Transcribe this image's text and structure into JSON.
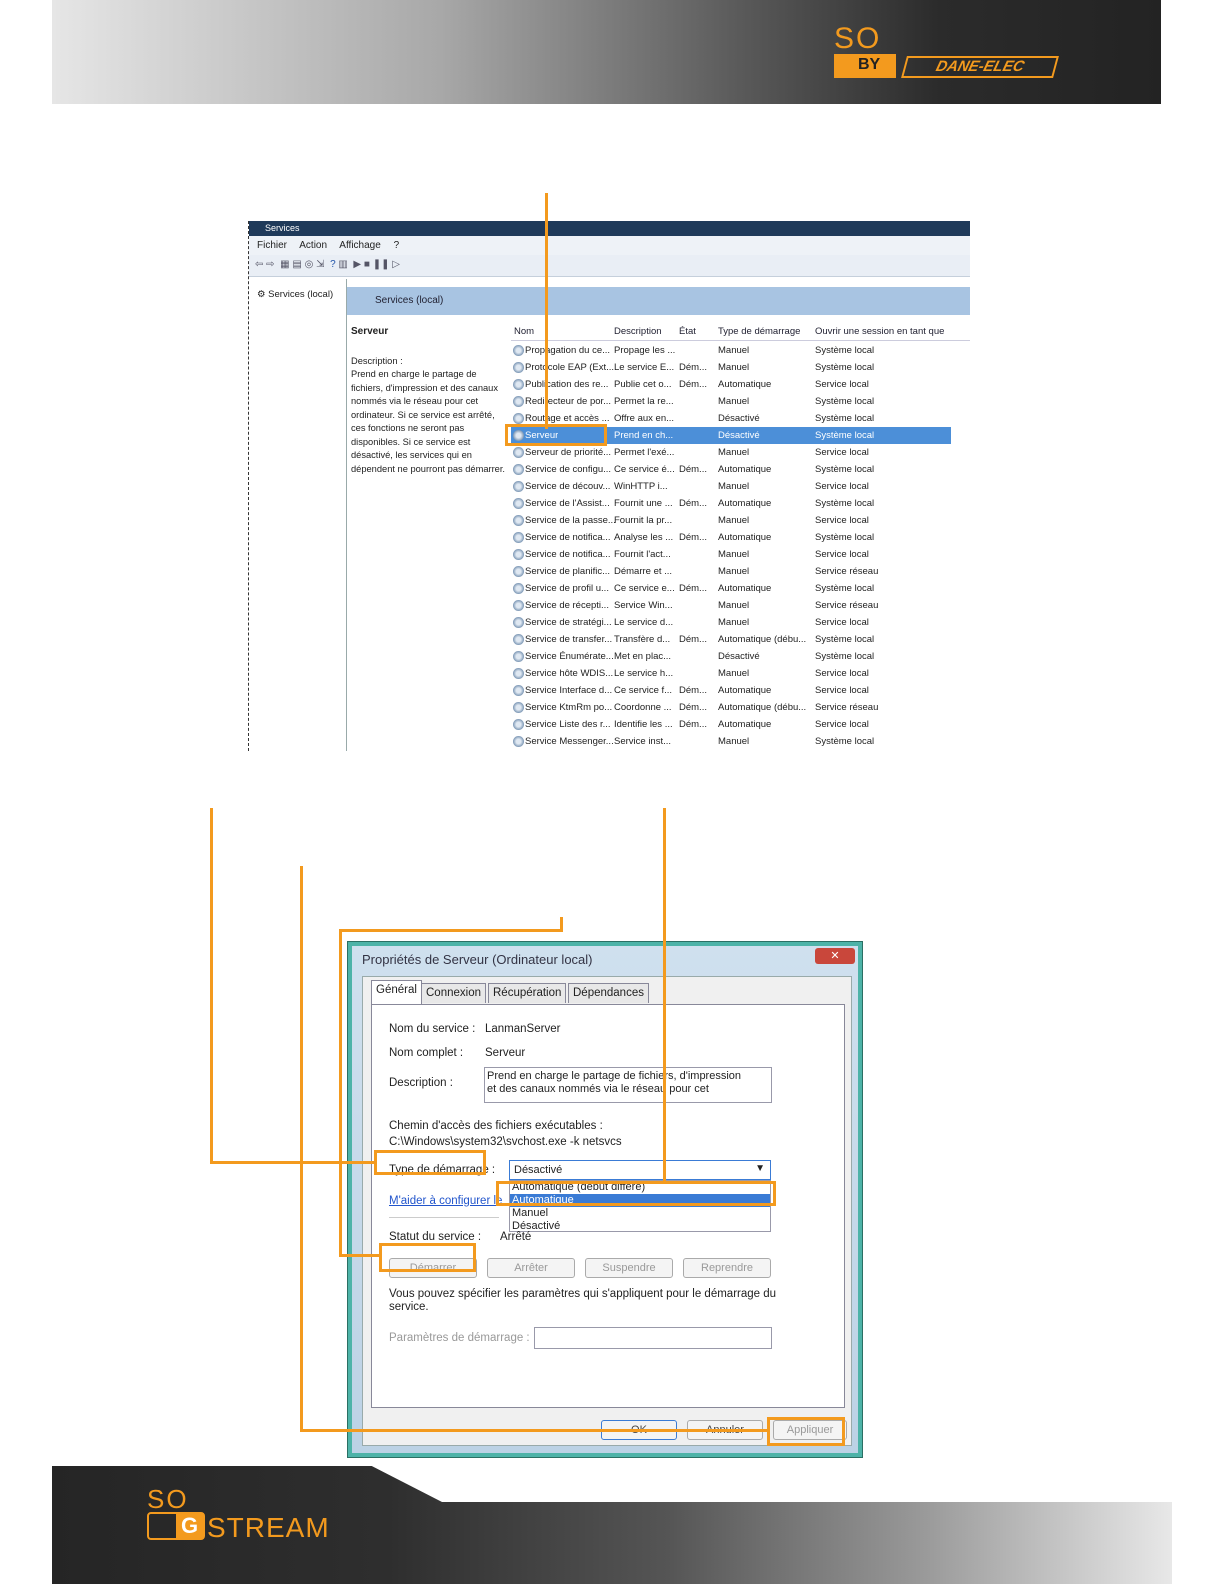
{
  "header": {
    "brand_top": "SO",
    "brand_by": "BY",
    "brand_name": "DANE-ELEC"
  },
  "footer": {
    "brand_top": "SO",
    "brand_g": "G",
    "brand_name": "STREAM"
  },
  "services_window": {
    "title": "Services",
    "menu": [
      "Fichier",
      "Action",
      "Affichage",
      "?"
    ],
    "tree_item": "Services (local)",
    "right_header": "Services (local)",
    "selected_name": "Serveur",
    "description_label": "Description :",
    "description_text": "Prend en charge le partage de fichiers, d'impression et des canaux nommés via le réseau pour cet ordinateur. Si ce service est arrêté, ces fonctions ne seront pas disponibles. Si ce service est désactivé, les services qui en dépendent ne pourront pas démarrer.",
    "columns": [
      "Nom",
      "Description",
      "État",
      "Type de démarrage",
      "Ouvrir une session en tant que"
    ],
    "rows": [
      [
        "Propagation du ce...",
        "Propage les ...",
        "",
        "Manuel",
        "Système local"
      ],
      [
        "Protocole EAP (Ext...",
        "Le service E...",
        "Dém...",
        "Manuel",
        "Système local"
      ],
      [
        "Publication des re...",
        "Publie cet o...",
        "Dém...",
        "Automatique",
        "Service local"
      ],
      [
        "Redirecteur de por...",
        "Permet la re...",
        "",
        "Manuel",
        "Système local"
      ],
      [
        "Routage et accès ...",
        "Offre aux en...",
        "",
        "Désactivé",
        "Système local"
      ],
      [
        "Serveur",
        "Prend en ch...",
        "",
        "Désactivé",
        "Système local"
      ],
      [
        "Serveur de priorité...",
        "Permet l'exé...",
        "",
        "Manuel",
        "Service local"
      ],
      [
        "Service de configu...",
        "Ce service é...",
        "Dém...",
        "Automatique",
        "Système local"
      ],
      [
        "Service de découv...",
        "WinHTTP i...",
        "",
        "Manuel",
        "Service local"
      ],
      [
        "Service de l'Assist...",
        "Fournit une ...",
        "Dém...",
        "Automatique",
        "Système local"
      ],
      [
        "Service de la passe...",
        "Fournit la pr...",
        "",
        "Manuel",
        "Service local"
      ],
      [
        "Service de notifica...",
        "Analyse les ...",
        "Dém...",
        "Automatique",
        "Système local"
      ],
      [
        "Service de notifica...",
        "Fournit l'act...",
        "",
        "Manuel",
        "Service local"
      ],
      [
        "Service de planific...",
        "Démarre et ...",
        "",
        "Manuel",
        "Service réseau"
      ],
      [
        "Service de profil u...",
        "Ce service e...",
        "Dém...",
        "Automatique",
        "Système local"
      ],
      [
        "Service de récepti...",
        "Service Win...",
        "",
        "Manuel",
        "Service réseau"
      ],
      [
        "Service de stratégi...",
        "Le service d...",
        "",
        "Manuel",
        "Service local"
      ],
      [
        "Service de transfer...",
        "Transfère d...",
        "Dém...",
        "Automatique (débu...",
        "Système local"
      ],
      [
        "Service Énumérate...",
        "Met en plac...",
        "",
        "Désactivé",
        "Système local"
      ],
      [
        "Service hôte WDIS...",
        "Le service h...",
        "",
        "Manuel",
        "Service local"
      ],
      [
        "Service Interface d...",
        "Ce service f...",
        "Dém...",
        "Automatique",
        "Service local"
      ],
      [
        "Service KtmRm po...",
        "Coordonne ...",
        "Dém...",
        "Automatique (débu...",
        "Service réseau"
      ],
      [
        "Service Liste des r...",
        "Identifie les ...",
        "Dém...",
        "Automatique",
        "Service local"
      ],
      [
        "Service Messenger...",
        "Service inst...",
        "",
        "Manuel",
        "Système local"
      ]
    ]
  },
  "dialog": {
    "title": "Propriétés de Serveur (Ordinateur local)",
    "close": "✕",
    "tabs": [
      "Général",
      "Connexion",
      "Récupération",
      "Dépendances"
    ],
    "service_name_label": "Nom du service :",
    "service_name": "LanmanServer",
    "full_name_label": "Nom complet :",
    "full_name": "Serveur",
    "description_label": "Description :",
    "description": "Prend en charge le partage de fichiers, d'impression et des canaux nommés via le réseau pour cet",
    "path_label": "Chemin d'accès des fichiers exécutables :",
    "path": "C:\\Windows\\system32\\svchost.exe -k netsvcs",
    "startup_label": "Type de démarrage :",
    "startup_value": "Désactivé",
    "startup_options": [
      "Automatique (début différé)",
      "Automatique",
      "Manuel",
      "Désactivé"
    ],
    "help_link": "M'aider à configurer le",
    "status_label": "Statut du service :",
    "status_value": "Arrêté",
    "buttons": [
      "Démarrer",
      "Arrêter",
      "Suspendre",
      "Reprendre"
    ],
    "params_note": "Vous pouvez spécifier les paramètres qui s'appliquent pour le démarrage du service.",
    "params_label": "Paramètres de démarrage :",
    "footer_buttons": [
      "OK",
      "Annuler",
      "Appliquer"
    ]
  }
}
